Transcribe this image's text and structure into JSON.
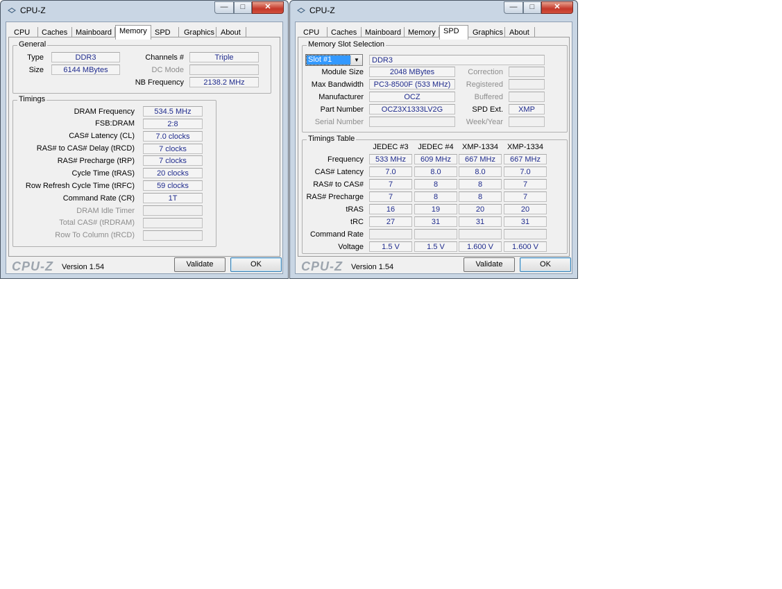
{
  "left_window": {
    "title": "CPU-Z",
    "tabs": [
      "CPU",
      "Caches",
      "Mainboard",
      "Memory",
      "SPD",
      "Graphics",
      "About"
    ],
    "active_tab": "Memory",
    "general": {
      "group_label": "General",
      "type_label": "Type",
      "type_value": "DDR3",
      "size_label": "Size",
      "size_value": "6144 MBytes",
      "channels_label": "Channels #",
      "channels_value": "Triple",
      "dc_mode_label": "DC Mode",
      "dc_mode_value": "",
      "nb_freq_label": "NB Frequency",
      "nb_freq_value": "2138.2 MHz"
    },
    "timings": {
      "group_label": "Timings",
      "rows": [
        {
          "label": "DRAM Frequency",
          "value": "534.5 MHz",
          "enabled": true
        },
        {
          "label": "FSB:DRAM",
          "value": "2:8",
          "enabled": true
        },
        {
          "label": "CAS# Latency (CL)",
          "value": "7.0 clocks",
          "enabled": true
        },
        {
          "label": "RAS# to CAS# Delay (tRCD)",
          "value": "7 clocks",
          "enabled": true
        },
        {
          "label": "RAS# Precharge (tRP)",
          "value": "7 clocks",
          "enabled": true
        },
        {
          "label": "Cycle Time (tRAS)",
          "value": "20 clocks",
          "enabled": true
        },
        {
          "label": "Row Refresh Cycle Time (tRFC)",
          "value": "59 clocks",
          "enabled": true
        },
        {
          "label": "Command Rate (CR)",
          "value": "1T",
          "enabled": true
        },
        {
          "label": "DRAM Idle Timer",
          "value": "",
          "enabled": false
        },
        {
          "label": "Total CAS# (tRDRAM)",
          "value": "",
          "enabled": false
        },
        {
          "label": "Row To Column (tRCD)",
          "value": "",
          "enabled": false
        }
      ]
    },
    "brand": "CPU-Z",
    "version": "Version 1.54",
    "validate_label": "Validate",
    "ok_label": "OK"
  },
  "right_window": {
    "title": "CPU-Z",
    "tabs": [
      "CPU",
      "Caches",
      "Mainboard",
      "Memory",
      "SPD",
      "Graphics",
      "About"
    ],
    "active_tab": "SPD",
    "slot": {
      "group_label": "Memory Slot Selection",
      "selected": "Slot #1",
      "type_value": "DDR3",
      "module_size_label": "Module Size",
      "module_size_value": "2048 MBytes",
      "max_bw_label": "Max Bandwidth",
      "max_bw_value": "PC3-8500F (533 MHz)",
      "manufacturer_label": "Manufacturer",
      "manufacturer_value": "OCZ",
      "part_label": "Part Number",
      "part_value": "OCZ3X1333LV2G",
      "serial_label": "Serial Number",
      "serial_value": "",
      "correction_label": "Correction",
      "correction_value": "",
      "registered_label": "Registered",
      "registered_value": "",
      "buffered_label": "Buffered",
      "buffered_value": "",
      "spd_ext_label": "SPD Ext.",
      "spd_ext_value": "XMP",
      "week_label": "Week/Year",
      "week_value": ""
    },
    "timings_table": {
      "group_label": "Timings Table",
      "columns": [
        "JEDEC #3",
        "JEDEC #4",
        "XMP-1334",
        "XMP-1334"
      ],
      "rows": [
        {
          "label": "Frequency",
          "values": [
            "533 MHz",
            "609 MHz",
            "667 MHz",
            "667 MHz"
          ]
        },
        {
          "label": "CAS# Latency",
          "values": [
            "7.0",
            "8.0",
            "8.0",
            "7.0"
          ]
        },
        {
          "label": "RAS# to CAS#",
          "values": [
            "7",
            "8",
            "8",
            "7"
          ]
        },
        {
          "label": "RAS# Precharge",
          "values": [
            "7",
            "8",
            "8",
            "7"
          ]
        },
        {
          "label": "tRAS",
          "values": [
            "16",
            "19",
            "20",
            "20"
          ]
        },
        {
          "label": "tRC",
          "values": [
            "27",
            "31",
            "31",
            "31"
          ]
        },
        {
          "label": "Command Rate",
          "values": [
            "",
            "",
            "",
            ""
          ]
        },
        {
          "label": "Voltage",
          "values": [
            "1.5 V",
            "1.5 V",
            "1.600 V",
            "1.600 V"
          ]
        }
      ]
    },
    "brand": "CPU-Z",
    "version": "Version 1.54",
    "validate_label": "Validate",
    "ok_label": "OK"
  }
}
